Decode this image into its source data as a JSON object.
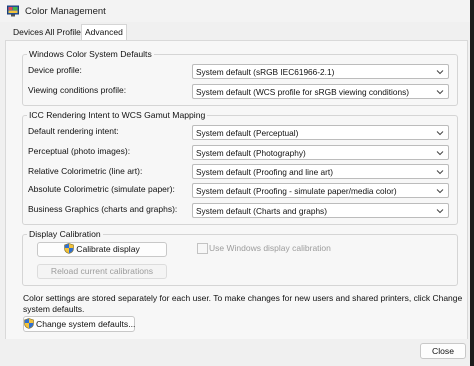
{
  "window": {
    "title": "Color Management"
  },
  "tabs": [
    "Devices",
    "All Profiles",
    "Advanced"
  ],
  "wcs_defaults": {
    "legend": "Windows Color System Defaults",
    "rows": [
      {
        "label": "Device profile:",
        "value": "System default (sRGB IEC61966-2.1)"
      },
      {
        "label": "Viewing conditions profile:",
        "value": "System default (WCS profile for sRGB viewing conditions)"
      }
    ]
  },
  "icc_mapping": {
    "legend": "ICC Rendering Intent to WCS Gamut Mapping",
    "rows": [
      {
        "label": "Default rendering intent:",
        "value": "System default (Perceptual)"
      },
      {
        "label": "Perceptual (photo images):",
        "value": "System default (Photography)"
      },
      {
        "label": "Relative Colorimetric (line art):",
        "value": "System default (Proofing and line art)"
      },
      {
        "label": "Absolute Colorimetric (simulate paper):",
        "value": "System default (Proofing - simulate paper/media color)"
      },
      {
        "label": "Business Graphics (charts and graphs):",
        "value": "System default (Charts and graphs)"
      }
    ]
  },
  "calibration": {
    "legend": "Display Calibration",
    "calibrate_button": "Calibrate display",
    "use_windows_calibration": "Use Windows display calibration",
    "reload_button": "Reload current calibrations"
  },
  "note": "Color settings are stored separately for each user. To make changes for new users and shared printers, click Change system defaults.",
  "change_defaults_button": "Change system defaults...",
  "close_button": "Close"
}
